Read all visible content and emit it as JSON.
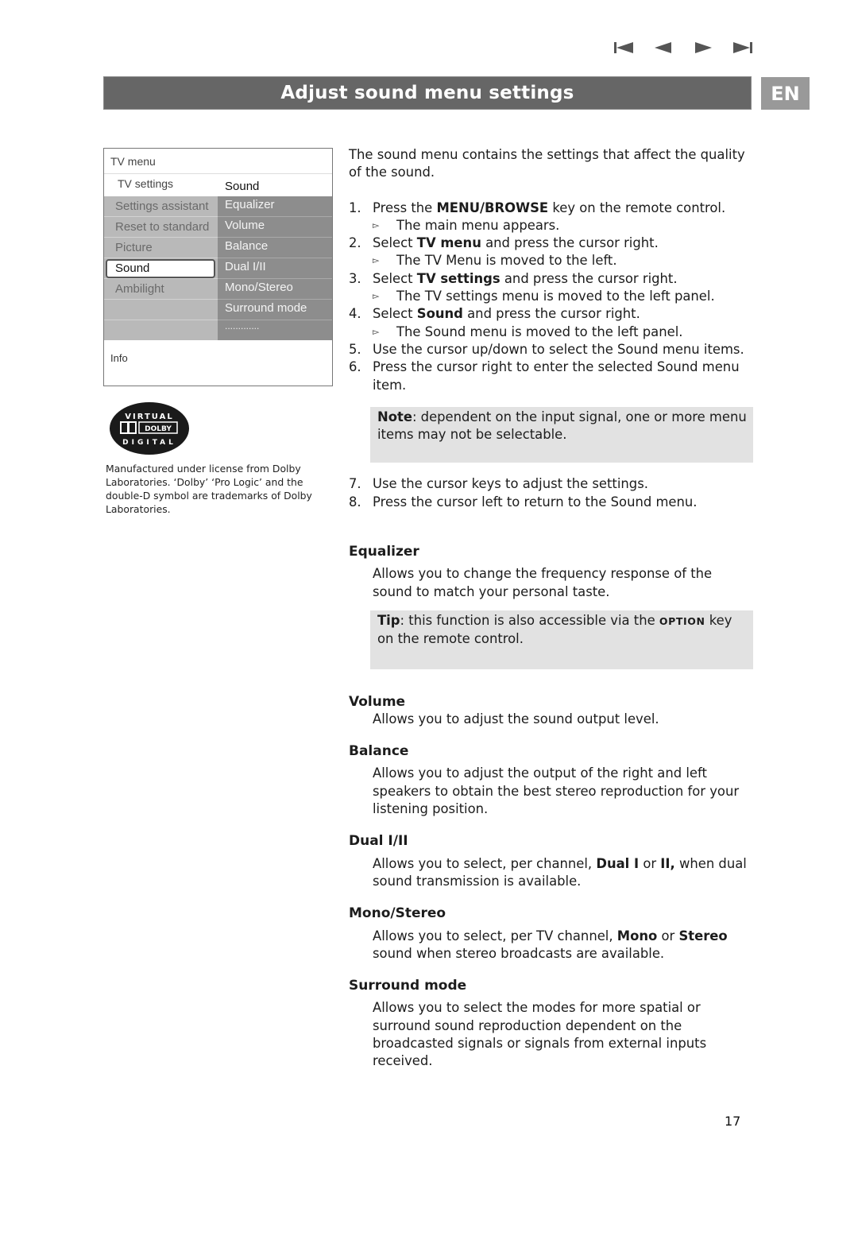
{
  "navigation": {
    "first_icon": "skip-to-first-icon",
    "prev_icon": "previous-icon",
    "next_icon": "next-icon",
    "last_icon": "skip-to-last-icon"
  },
  "header": {
    "title": "Adjust sound menu settings",
    "language": "EN"
  },
  "tv_menu": {
    "title": "TV menu",
    "breadcrumb_left": "TV settings",
    "breadcrumb_right": "Sound",
    "left_items": [
      "Settings assistant",
      "Reset to standard",
      "Picture",
      "Sound",
      "Ambilight",
      "",
      ""
    ],
    "selected_left": "Sound",
    "right_items": [
      "Equalizer",
      "Volume",
      "Balance",
      "Dual I/II",
      "Mono/Stereo",
      "Surround mode",
      "............."
    ],
    "info_label": "Info"
  },
  "dolby": {
    "logo_top": "VIRTUAL",
    "logo_mid": "DOLBY",
    "logo_bottom": "DIGITAL",
    "credit": "Manufactured under license from Dolby Laboratories. ‘Dolby’ ‘Pro Logic’ and the double-D symbol are trademarks of Dolby Laboratories."
  },
  "intro": "The sound menu contains the settings that affect the quality of the sound.",
  "steps": [
    {
      "num": "1.",
      "pre": "Press the ",
      "bold": "MENU/BROWSE",
      "post": " key on the remote control.",
      "sub": "The main menu appears."
    },
    {
      "num": "2.",
      "pre": "Select ",
      "bold": "TV menu",
      "post": " and press the cursor right.",
      "sub": "The TV Menu is moved to the left."
    },
    {
      "num": "3.",
      "pre": "Select ",
      "bold": "TV settings",
      "post": " and press the cursor right.",
      "sub": "The TV settings menu is moved to the left panel."
    },
    {
      "num": "4.",
      "pre": "Select ",
      "bold": "Sound",
      "post": " and press the cursor right.",
      "sub": "The Sound menu is moved to the left panel."
    },
    {
      "num": "5.",
      "text": "Use the cursor up/down to select the Sound menu items."
    },
    {
      "num": "6.",
      "text": "Press the cursor right to enter the selected Sound menu item."
    }
  ],
  "note": {
    "label": "Note",
    "text": ": dependent on the input signal, one or more menu items may not be selectable."
  },
  "steps2": [
    {
      "num": "7.",
      "text": "Use the cursor keys to adjust the settings."
    },
    {
      "num": "8.",
      "text": "Press the cursor left to return to the Sound menu."
    }
  ],
  "sections": {
    "equalizer": {
      "heading": "Equalizer",
      "body": "Allows you to change the frequency response of the sound to match your personal taste.",
      "tip_label": "Tip",
      "tip_pre": ": this function is also accessible via the ",
      "tip_key": "OPTION",
      "tip_post": " key on the remote control."
    },
    "volume": {
      "heading": "Volume",
      "body": "Allows you to adjust the sound output level."
    },
    "balance": {
      "heading": "Balance",
      "body": "Allows you to adjust the output of the right and left speakers to obtain the best stereo reproduction for your listening position."
    },
    "dual": {
      "heading": "Dual I/II",
      "pre": "Allows you to select, per channel, ",
      "b1": "Dual I",
      "mid": " or ",
      "b2": "II,",
      "post": " when dual sound transmission is available."
    },
    "mono": {
      "heading": "Mono/Stereo",
      "pre": "Allows you to select, per TV channel, ",
      "b1": "Mono",
      "mid": " or ",
      "b2": "Stereo",
      "post": " sound when stereo broadcasts are available."
    },
    "surround": {
      "heading": "Surround mode",
      "body": "Allows you to select the modes for more spatial or surround sound reproduction dependent on the broadcasted signals or signals from external inputs received."
    }
  },
  "page_number": "17",
  "colors": {
    "title_bar": "#666666",
    "lang_badge": "#999999",
    "note_bg": "#e2e2e2",
    "menu_left": "#b9b9b9",
    "menu_right": "#8d8d8d"
  }
}
